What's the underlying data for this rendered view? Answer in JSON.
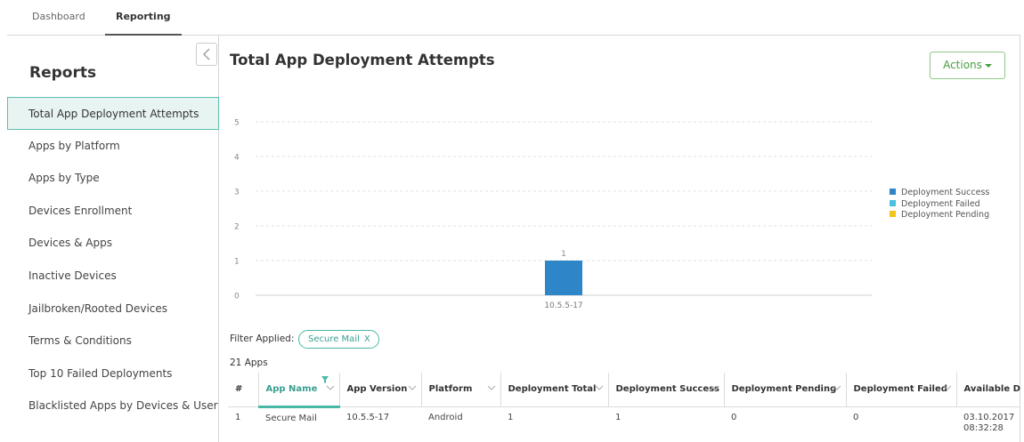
{
  "topnav": {
    "tabs": [
      {
        "label": "Dashboard",
        "active": false
      },
      {
        "label": "Reporting",
        "active": true
      }
    ]
  },
  "sidebar": {
    "title": "Reports",
    "items": [
      {
        "label": "Total App Deployment Attempts",
        "active": true
      },
      {
        "label": "Apps by Platform"
      },
      {
        "label": "Apps by Type"
      },
      {
        "label": "Devices Enrollment"
      },
      {
        "label": "Devices & Apps"
      },
      {
        "label": "Inactive Devices"
      },
      {
        "label": "Jailbroken/Rooted Devices"
      },
      {
        "label": "Terms & Conditions"
      },
      {
        "label": "Top 10 Failed Deployments"
      },
      {
        "label": "Blacklisted Apps by Devices & User"
      }
    ]
  },
  "main": {
    "title": "Total App Deployment Attempts",
    "actions_label": "Actions",
    "filter_label": "Filter Applied:",
    "filter_chip": "Secure Mail",
    "filter_remove": "X",
    "count_label": "21 Apps"
  },
  "chart_data": {
    "type": "bar",
    "categories": [
      "10.5.5-17"
    ],
    "series": [
      {
        "name": "Deployment Success",
        "values": [
          1
        ],
        "color": "#2e86c8"
      },
      {
        "name": "Deployment Failed",
        "values": [
          0
        ],
        "color": "#4bc0de"
      },
      {
        "name": "Deployment Pending",
        "values": [
          0
        ],
        "color": "#f0c419"
      }
    ],
    "data_labels": [
      "1"
    ],
    "yticks": [
      "0",
      "1",
      "2",
      "3",
      "4",
      "5"
    ],
    "ylim": [
      0,
      5
    ],
    "grid": true,
    "legend_position": "right"
  },
  "table": {
    "columns": [
      {
        "label": "#"
      },
      {
        "label": "App Name",
        "sorted": true,
        "filtered": true
      },
      {
        "label": "App Version"
      },
      {
        "label": "Platform"
      },
      {
        "label": "Deployment Total"
      },
      {
        "label": "Deployment Success"
      },
      {
        "label": "Deployment Pending"
      },
      {
        "label": "Deployment Failed"
      },
      {
        "label": "Available D"
      }
    ],
    "rows": [
      [
        "1",
        "Secure Mail",
        "10.5.5-17",
        "Android",
        "1",
        "1",
        "0",
        "0",
        "03.10.2017 08:32:28"
      ]
    ]
  },
  "colors": {
    "accent": "#4ab8a7",
    "actions": "#4a9d42"
  }
}
